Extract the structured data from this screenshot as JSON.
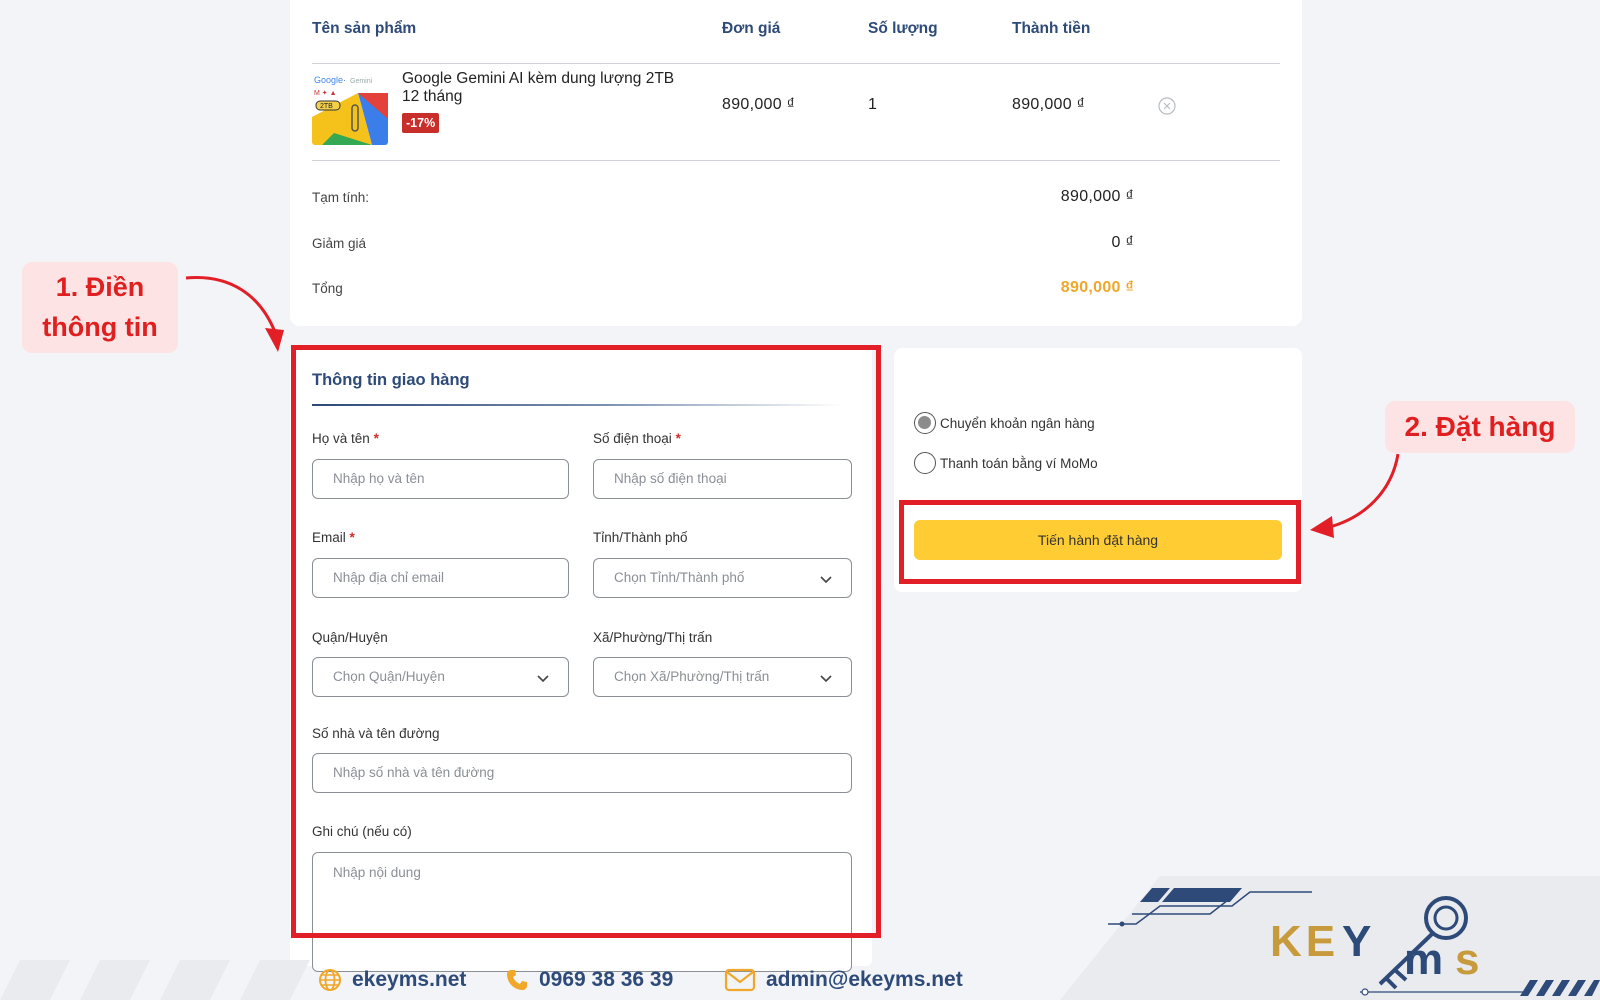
{
  "colors": {
    "navy": "#2d4a78",
    "accent_yellow": "#ffcd33",
    "total_orange": "#f0a72a",
    "highlight_red": "#e21e26",
    "discount_red": "#c82f2a"
  },
  "cart": {
    "headers": {
      "product": "Tên sản phẩm",
      "unit_price": "Đơn giá",
      "quantity": "Số lượng",
      "line_total": "Thành tiền"
    },
    "item": {
      "thumbnail_icon": "google-gemini-2tb-thumbnail",
      "name": "Google Gemini AI kèm dung lượng 2TB 12 tháng",
      "discount": "-17%",
      "unit_price": "890,000 ₫",
      "quantity": "1",
      "line_total": "890,000 ₫",
      "remove_icon": "circle-x-icon"
    },
    "summary": {
      "subtotal_label": "Tạm tính:",
      "subtotal_value": "890,000 ₫",
      "discount_label": "Giảm giá",
      "discount_value": "0 ₫",
      "total_label": "Tổng",
      "total_value": "890,000 ₫"
    }
  },
  "shipping": {
    "title": "Thông tin giao hàng",
    "fields": {
      "name_label": "Họ và tên",
      "name_placeholder": "Nhập họ và tên",
      "phone_label": "Số điện thoại",
      "phone_placeholder": "Nhập số điện thoại",
      "email_label": "Email",
      "email_placeholder": "Nhập địa chỉ email",
      "province_label": "Tỉnh/Thành phố",
      "province_placeholder": "Chọn Tỉnh/Thành phố",
      "district_label": "Quận/Huyện",
      "district_placeholder": "Chọn Quận/Huyện",
      "ward_label": "Xã/Phường/Thị trấn",
      "ward_placeholder": "Chọn Xã/Phường/Thị trấn",
      "street_label": "Số nhà và tên đường",
      "street_placeholder": "Nhập số nhà và tên đường",
      "note_label": "Ghi chú (nếu có)",
      "note_placeholder": "Nhập nội dung"
    },
    "required_mark": "*"
  },
  "payment": {
    "options": [
      {
        "label": "Chuyển khoản ngân hàng",
        "selected": true
      },
      {
        "label": "Thanh toán bằng ví MoMo",
        "selected": false
      }
    ],
    "submit_label": "Tiến hành đặt hàng"
  },
  "annotations": {
    "step1_line1": "1. Điền",
    "step1_line2": "thông tin",
    "step2": "2. Đặt hàng"
  },
  "footer": {
    "website": "ekeyms.net",
    "phone": "0969 38 36 39",
    "email": "admin@ekeyms.net",
    "website_icon": "globe-icon",
    "phone_icon": "phone-icon",
    "email_icon": "mail-icon",
    "brand_logo": "KEYMS"
  }
}
